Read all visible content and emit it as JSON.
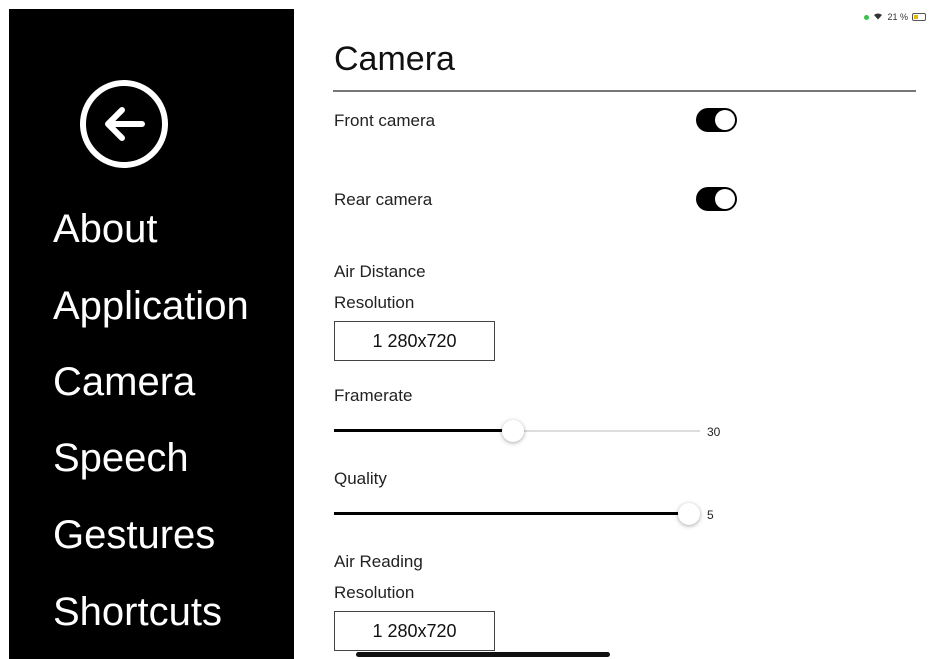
{
  "status_bar": {
    "battery_text": "21 %",
    "icons": [
      "dot-indicator",
      "wifi-icon",
      "battery-icon"
    ]
  },
  "sidebar": {
    "back_icon": "arrow-left-circle-icon",
    "items": [
      {
        "label": "About"
      },
      {
        "label": "Application"
      },
      {
        "label": "Camera"
      },
      {
        "label": "Speech"
      },
      {
        "label": "Gestures"
      },
      {
        "label": "Shortcuts"
      }
    ]
  },
  "main": {
    "title": "Camera",
    "front_camera": {
      "label": "Front camera",
      "enabled": true
    },
    "rear_camera": {
      "label": "Rear camera",
      "enabled": true
    },
    "air_distance": {
      "heading": "Air Distance",
      "resolution_label": "Resolution",
      "resolution_value": "1 280x720",
      "framerate_label": "Framerate",
      "framerate_value": "30",
      "framerate_level": 0.49,
      "quality_label": "Quality",
      "quality_value": "5",
      "quality_level": 0.97
    },
    "air_reading": {
      "heading": "Air Reading",
      "resolution_label": "Resolution",
      "resolution_value": "1 280x720"
    }
  },
  "colors": {
    "sidebar_bg": "#000000",
    "toggle_on": "#000000",
    "slider_fill": "#000000"
  }
}
